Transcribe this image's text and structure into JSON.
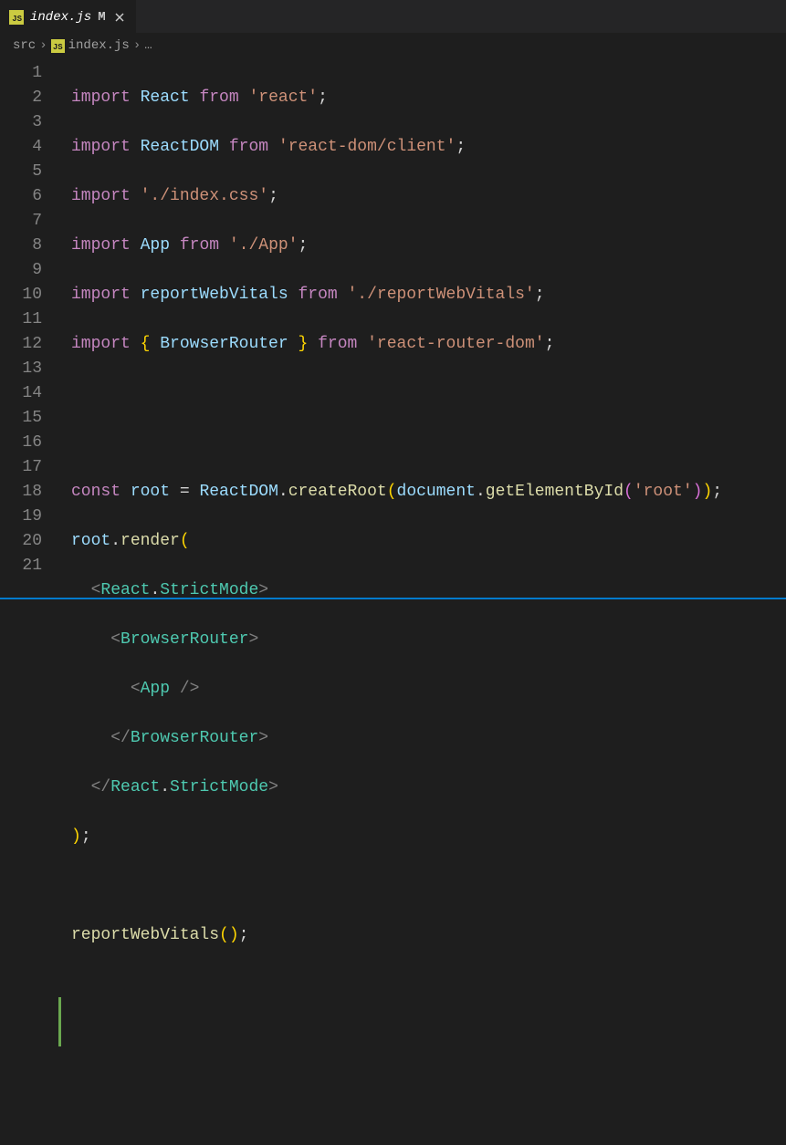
{
  "tab": {
    "filename": "index.js",
    "modified_marker": "M",
    "icon_label": "JS"
  },
  "breadcrumb": {
    "folder": "src",
    "filename": "index.js",
    "ellipsis": "…"
  },
  "gutter": {
    "line_numbers": [
      "1",
      "2",
      "3",
      "4",
      "5",
      "6",
      "7",
      "8",
      "9",
      "10",
      "11",
      "12",
      "13",
      "14",
      "15",
      "16",
      "17",
      "18",
      "19",
      "20",
      "21"
    ]
  },
  "code": {
    "l1": {
      "kw1": "import",
      "id": "React",
      "kw2": "from",
      "str": "'react'",
      "sc": ";"
    },
    "l2": {
      "kw1": "import",
      "id": "ReactDOM",
      "kw2": "from",
      "str": "'react-dom/client'",
      "sc": ";"
    },
    "l3": {
      "kw1": "import",
      "str": "'./index.css'",
      "sc": ";"
    },
    "l4": {
      "kw1": "import",
      "id": "App",
      "kw2": "from",
      "str": "'./App'",
      "sc": ";"
    },
    "l5": {
      "kw1": "import",
      "id": "reportWebVitals",
      "kw2": "from",
      "str": "'./reportWebVitals'",
      "sc": ";"
    },
    "l6": {
      "kw1": "import",
      "lb": "{ ",
      "id": "BrowserRouter",
      "rb": " }",
      "kw2": "from",
      "str": "'react-router-dom'",
      "sc": ";"
    },
    "l9": {
      "kw": "const",
      "id": "root",
      "eq": " = ",
      "cls": "ReactDOM",
      "dot1": ".",
      "fn1": "createRoot",
      "p1": "(",
      "id2": "document",
      "dot2": ".",
      "fn2": "getElementById",
      "p2": "(",
      "str": "'root'",
      "p3": ")",
      ")": ")",
      "sc": ";"
    },
    "l10": {
      "id": "root",
      "dot": ".",
      "fn": "render",
      "p": "("
    },
    "l11": {
      "lt": "<",
      "cls": "React",
      "dot": ".",
      "mode": "StrictMode",
      "gt": ">"
    },
    "l12": {
      "lt": "<",
      "cls": "BrowserRouter",
      "gt": ">"
    },
    "l13": {
      "lt": "<",
      "cls": "App",
      "sl": " /",
      "gt": ">"
    },
    "l14": {
      "lt": "</",
      "cls": "BrowserRouter",
      "gt": ">"
    },
    "l15": {
      "lt": "</",
      "cls": "React",
      "dot": ".",
      "mode": "StrictMode",
      "gt": ">"
    },
    "l16": {
      "p": ")",
      "sc": ";"
    },
    "l18": {
      "fn": "reportWebVitals",
      "p1": "(",
      "p2": ")",
      "sc": ";"
    }
  }
}
